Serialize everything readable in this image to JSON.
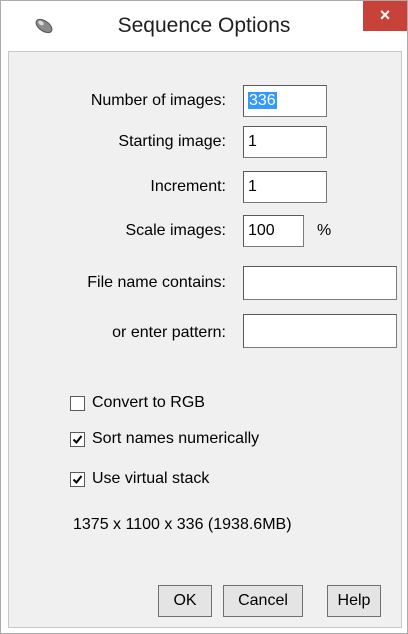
{
  "window": {
    "title": "Sequence Options",
    "close_glyph": "×",
    "app_icon": "imagej-microscope-icon"
  },
  "fields": {
    "num_images": {
      "label": "Number of images:",
      "value": "336"
    },
    "starting_image": {
      "label": "Starting image:",
      "value": "1"
    },
    "increment": {
      "label": "Increment:",
      "value": "1"
    },
    "scale_images": {
      "label": "Scale images:",
      "value": "100",
      "unit": "%"
    },
    "file_name_contains": {
      "label": "File name contains:",
      "value": ""
    },
    "pattern": {
      "label": "or enter pattern:",
      "value": ""
    }
  },
  "options": [
    {
      "label": "Convert to RGB",
      "checked": false
    },
    {
      "label": "Sort names numerically",
      "checked": true
    },
    {
      "label": "Use virtual stack",
      "checked": true
    }
  ],
  "info": "1375 x 1100 x 336 (1938.6MB)",
  "buttons": {
    "ok": "OK",
    "cancel": "Cancel",
    "help": "Help"
  }
}
